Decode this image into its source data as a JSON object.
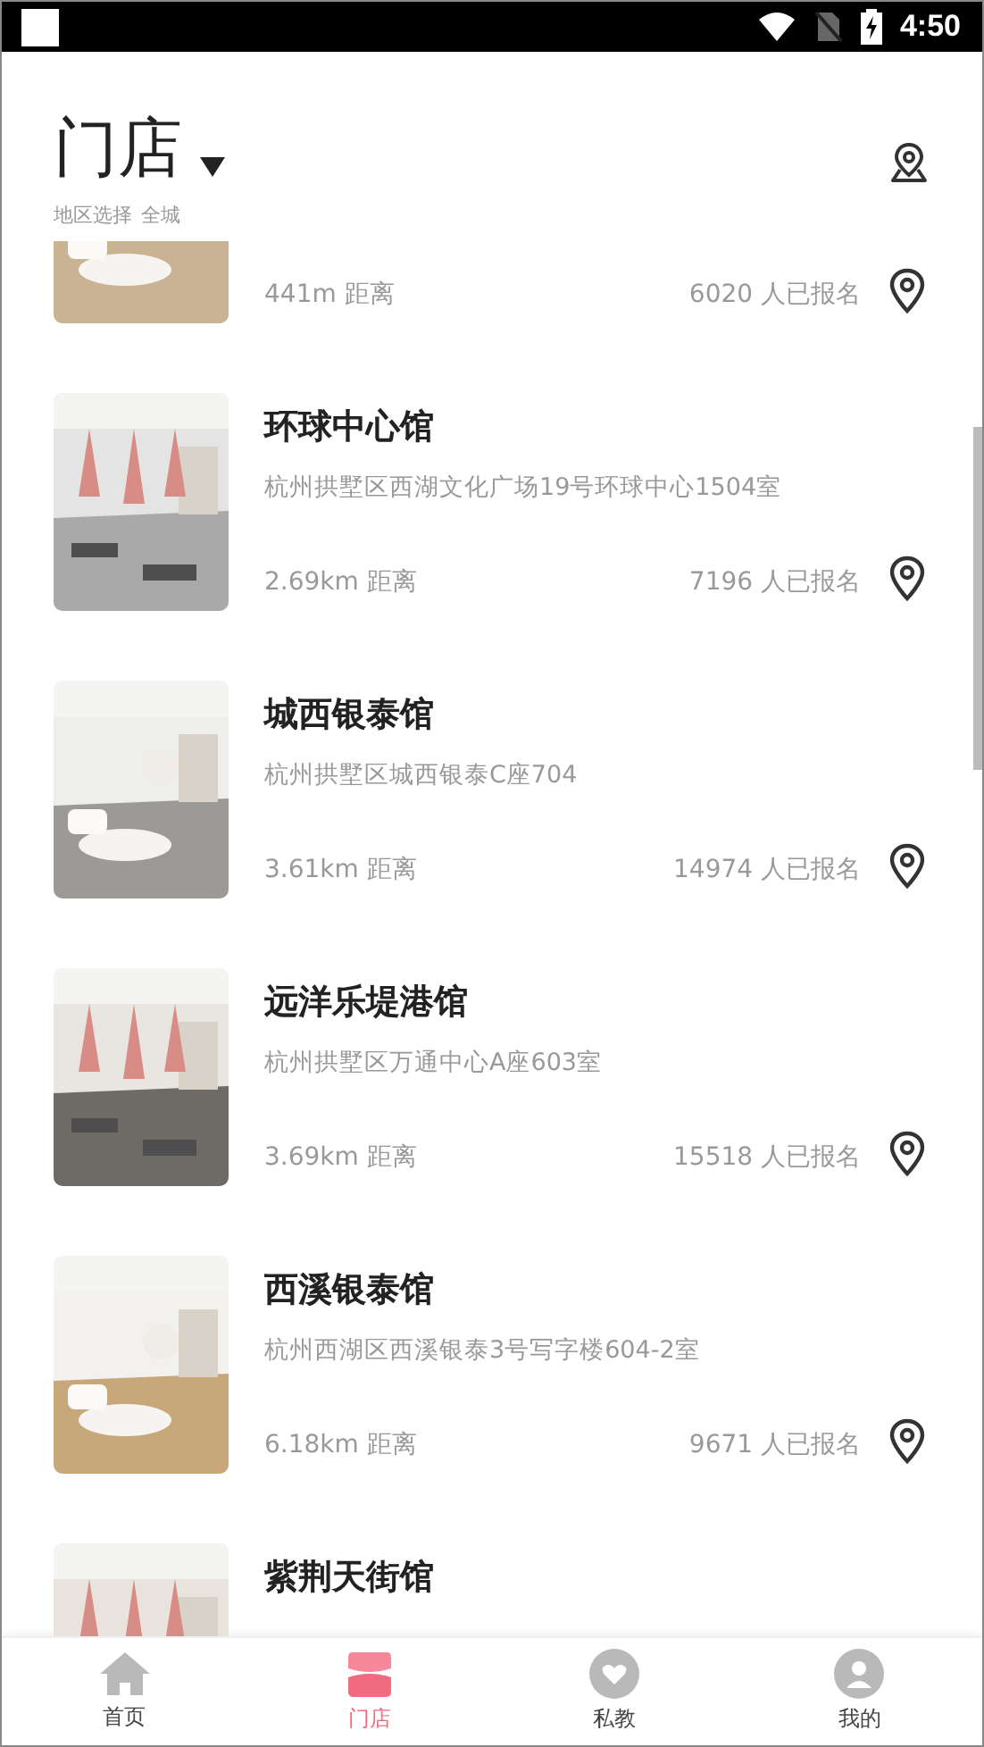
{
  "status_bar": {
    "time": "4:50"
  },
  "header": {
    "title": "门店",
    "region_label": "地区选择",
    "region_value": "全城"
  },
  "stores": [
    {
      "distance": "441m 距离",
      "signups": "6020 人已报名"
    },
    {
      "name": "环球中心馆",
      "address": "杭州拱墅区西湖文化广场19号环球中心1504室",
      "distance": "2.69km 距离",
      "signups": "7196 人已报名"
    },
    {
      "name": "城西银泰馆",
      "address": "杭州拱墅区城西银泰C座704",
      "distance": "3.61km 距离",
      "signups": "14974 人已报名"
    },
    {
      "name": "远洋乐堤港馆",
      "address": "杭州拱墅区万通中心A座603室",
      "distance": "3.69km 距离",
      "signups": "15518 人已报名"
    },
    {
      "name": "西溪银泰馆",
      "address": "杭州西湖区西溪银泰3号写字楼604-2室",
      "distance": "6.18km 距离",
      "signups": "9671 人已报名"
    },
    {
      "name": "紫荆天街馆"
    }
  ],
  "tabs": [
    {
      "label": "首页",
      "kind": "home",
      "selected": false
    },
    {
      "label": "门店",
      "kind": "store",
      "selected": true
    },
    {
      "label": "私教",
      "kind": "coach",
      "selected": false
    },
    {
      "label": "我的",
      "kind": "profile",
      "selected": false
    }
  ]
}
